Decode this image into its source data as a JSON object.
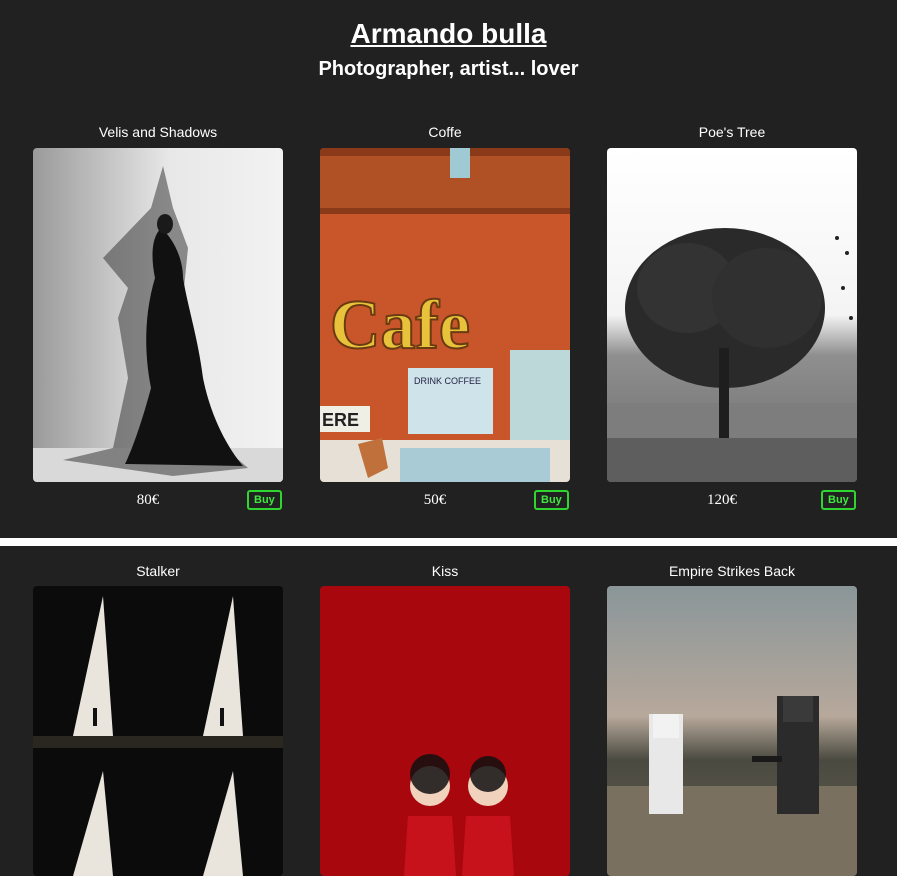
{
  "header": {
    "title": "Armando bulla",
    "subtitle": "Photographer, artist... lover"
  },
  "products": [
    {
      "title": "Velis and Shadows",
      "price": "80€",
      "buy_label": "Buy"
    },
    {
      "title": "Coffe",
      "price": "50€",
      "buy_label": "Buy"
    },
    {
      "title": "Poe's Tree",
      "price": "120€",
      "buy_label": "Buy"
    },
    {
      "title": "Stalker"
    },
    {
      "title": "Kiss"
    },
    {
      "title": "Empire Strikes Back"
    }
  ],
  "photo_signs": {
    "cafe": "Cafe",
    "drink_coffee": "DRINK COFFEE",
    "arrow_sign": "ERE"
  },
  "colors": {
    "background": "#212121",
    "buy_accent": "#2fd62f",
    "separator": "#ffffff"
  }
}
